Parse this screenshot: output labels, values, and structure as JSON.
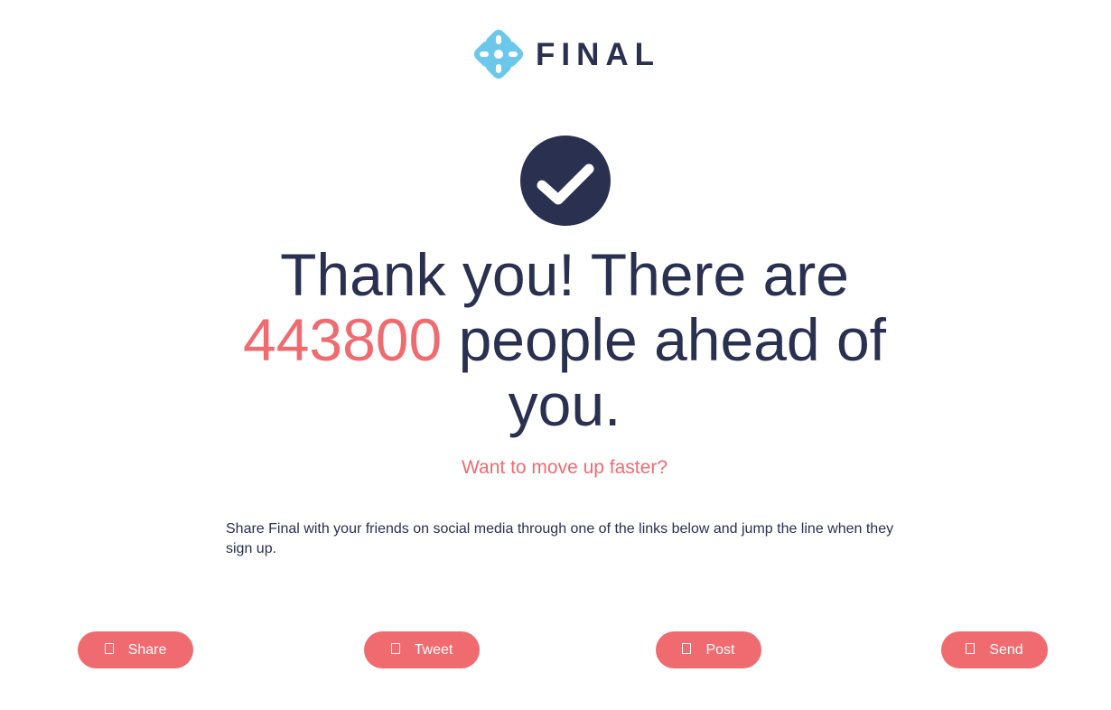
{
  "brand": {
    "name": "FINAL",
    "logo_icon": "final-logo-icon",
    "logo_color": "#6cc8ea"
  },
  "status": {
    "icon": "checkmark-icon"
  },
  "headline": {
    "part1": "Thank you! There are ",
    "count": "443800",
    "part2": " people ahead of you."
  },
  "subhead": "Want to move up faster?",
  "body": "Share Final with your friends on social media through one of the links below and jump the line when they sign up.",
  "share_buttons": [
    {
      "label": "Share",
      "icon": "facebook-icon"
    },
    {
      "label": "Tweet",
      "icon": "twitter-icon"
    },
    {
      "label": "Post",
      "icon": "linkedin-icon"
    },
    {
      "label": "Send",
      "icon": "email-icon"
    }
  ],
  "colors": {
    "primary": "#2a3050",
    "accent": "#ef6b70",
    "logo": "#6cc8ea"
  }
}
